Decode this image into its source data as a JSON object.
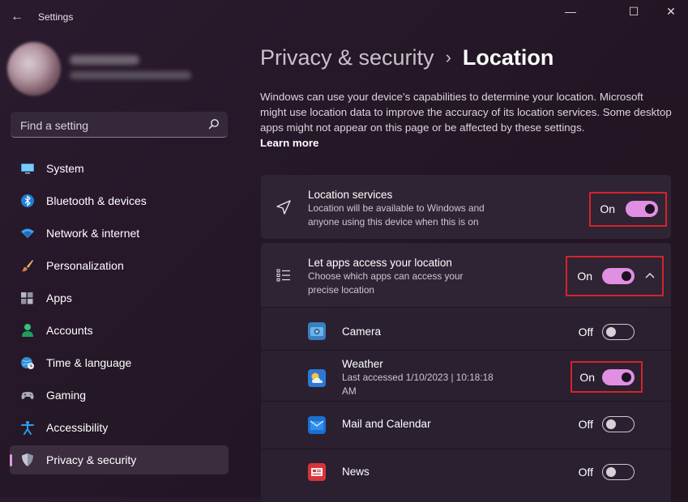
{
  "app": {
    "title": "Settings"
  },
  "window_controls": {
    "minimize": "—",
    "maximize": "☐",
    "close": "✕"
  },
  "search": {
    "placeholder": "Find a setting"
  },
  "sidebar": {
    "items": [
      {
        "label": "System",
        "icon": "monitor-icon"
      },
      {
        "label": "Bluetooth & devices",
        "icon": "bluetooth-icon"
      },
      {
        "label": "Network & internet",
        "icon": "wifi-icon"
      },
      {
        "label": "Personalization",
        "icon": "brush-icon"
      },
      {
        "label": "Apps",
        "icon": "apps-icon"
      },
      {
        "label": "Accounts",
        "icon": "person-icon"
      },
      {
        "label": "Time & language",
        "icon": "globe-clock-icon"
      },
      {
        "label": "Gaming",
        "icon": "gamepad-icon"
      },
      {
        "label": "Accessibility",
        "icon": "accessibility-icon"
      },
      {
        "label": "Privacy & security",
        "icon": "shield-icon",
        "active": true
      }
    ]
  },
  "breadcrumb": {
    "parent": "Privacy & security",
    "separator": "›",
    "current": "Location"
  },
  "description": {
    "text": "Windows can use your device’s capabilities to determine your location. Microsoft might use location data to improve the accuracy of its location services. Some desktop apps might not appear on this page or be affected by these settings.",
    "link": "Learn more"
  },
  "location_services": {
    "title": "Location services",
    "subtitle": "Location will be available to Windows and anyone using this device when this is on",
    "state": "On"
  },
  "apps_access": {
    "title": "Let apps access your location",
    "subtitle": "Choose which apps can access your precise location",
    "state": "On",
    "apps": [
      {
        "name": "Camera",
        "state": "Off",
        "icon": "camera-icon"
      },
      {
        "name": "Weather",
        "detail": "Last accessed 1/10/2023  |  10:18:18 AM",
        "state": "On",
        "icon": "weather-icon"
      },
      {
        "name": "Mail and Calendar",
        "state": "Off",
        "icon": "mail-icon"
      },
      {
        "name": "News",
        "state": "Off",
        "icon": "news-icon"
      }
    ]
  },
  "colors": {
    "accent": "#e08fe2",
    "highlight_box": "#d6222a"
  }
}
